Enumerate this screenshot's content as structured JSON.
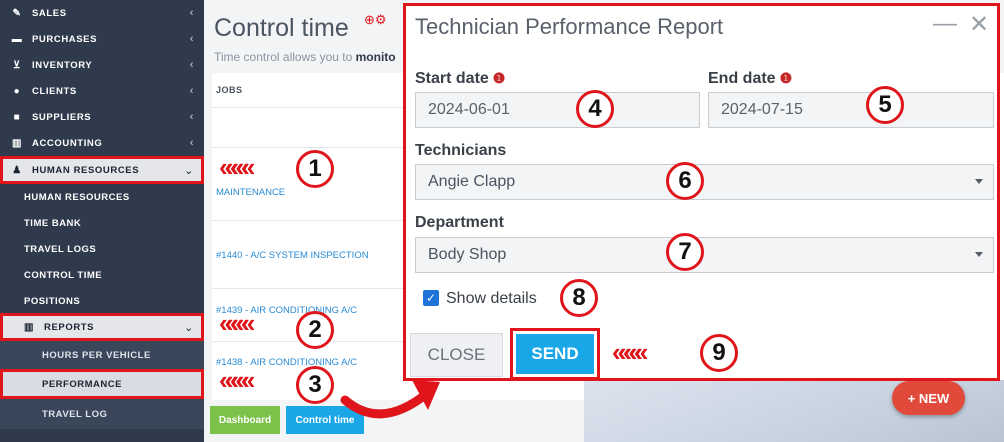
{
  "sidebar": {
    "items": [
      {
        "label": "SALES",
        "icon": "pencil-square-icon"
      },
      {
        "label": "PURCHASES",
        "icon": "card-icon"
      },
      {
        "label": "INVENTORY",
        "icon": "cart-icon"
      },
      {
        "label": "CLIENTS",
        "icon": "users-icon"
      },
      {
        "label": "SUPPLIERS",
        "icon": "truck-icon"
      },
      {
        "label": "ACCOUNTING",
        "icon": "bar-chart-icon"
      },
      {
        "label": "HUMAN RESOURCES",
        "icon": "user-icon"
      }
    ],
    "hr_submenu": [
      "HUMAN RESOURCES",
      "TIME BANK",
      "TRAVEL LOGS",
      "CONTROL TIME",
      "POSITIONS"
    ],
    "reports": {
      "label": "REPORTS",
      "icon": "bar-chart-icon"
    },
    "reports_submenu": [
      "HOURS PER VEHICLE",
      "PERFORMANCE",
      "TRAVEL LOG"
    ]
  },
  "page": {
    "title": "Control time",
    "subtitle_prefix": "Time control allows you to ",
    "subtitle_bold": "monito",
    "jobs_header": "JOBS",
    "jobs": [
      "MAINTENANCE",
      "#1440 - A/C SYSTEM INSPECTION",
      "#1439 - AIR CONDITIONING A/C",
      "#1438 - AIR CONDITIONING A/C"
    ],
    "dashboard_label": "Dashboard",
    "control_time_label": "Control time",
    "new_label": "+ NEW"
  },
  "modal": {
    "title": "Technician Performance Report",
    "start_date_label": "Start date",
    "start_date_value": "2024-06-01",
    "end_date_label": "End date",
    "end_date_value": "2024-07-15",
    "technicians_label": "Technicians",
    "technician_value": "Angie Clapp",
    "department_label": "Department",
    "department_value": "Body Shop",
    "show_details_label": "Show details",
    "show_details_checked": true,
    "close_label": "CLOSE",
    "send_label": "SEND"
  },
  "annotations": [
    "1",
    "2",
    "3",
    "4",
    "5",
    "6",
    "7",
    "8",
    "9"
  ],
  "colors": {
    "sidebar": "#2f3a4c",
    "highlight": "#e0141b",
    "send": "#1aa7e8",
    "new": "#e14a3b"
  }
}
